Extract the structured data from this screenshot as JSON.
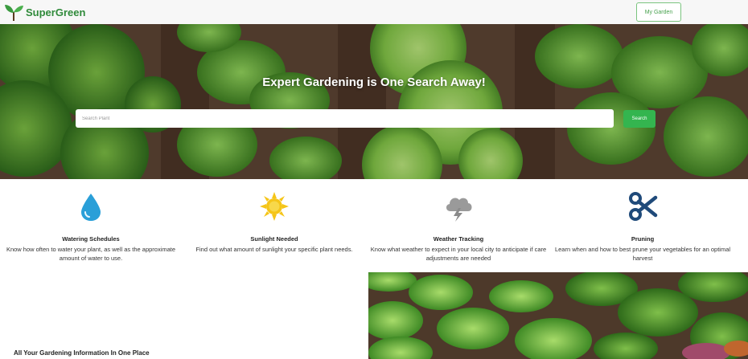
{
  "navbar": {
    "brand": "SuperGreen",
    "my_garden_label": "My Garden"
  },
  "hero": {
    "title": "Expert Gardening is One Search Away!",
    "search_placeholder": "Search Plant",
    "search_value": "",
    "search_button": "Search"
  },
  "features": [
    {
      "icon": "water-drop-icon",
      "title": "Watering Schedules",
      "description": "Know how often to water your plant, as well as the approximate amount of water to use."
    },
    {
      "icon": "sun-icon",
      "title": "Sunlight Needed",
      "description": "Find out what amount of sunlight your specific plant needs."
    },
    {
      "icon": "storm-cloud-icon",
      "title": "Weather Tracking",
      "description": "Know what weather to expect in your local city to anticipate if care adjustments are needed"
    },
    {
      "icon": "scissors-icon",
      "title": "Pruning",
      "description": "Learn when and how to best prune your vegetables for an optimal harvest"
    }
  ],
  "info_section": {
    "heading": "All Your Gardening Information In One Place"
  },
  "colors": {
    "brand_green": "#2f8a3a",
    "search_button": "#34b54f",
    "water_blue": "#2a9fd8",
    "sun_yellow": "#f5c518",
    "cloud_gray": "#9a9a9a",
    "scissors_navy": "#1f4a7a"
  }
}
